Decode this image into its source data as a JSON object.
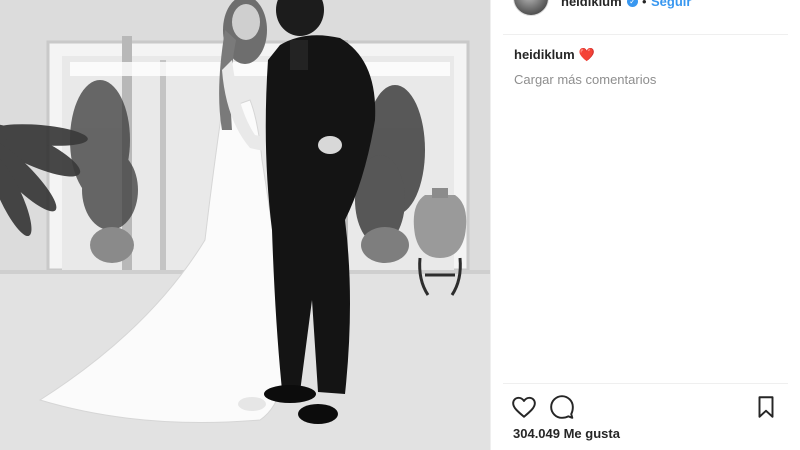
{
  "post": {
    "username": "heidiklum",
    "follow_label": "Seguir",
    "separator": "•",
    "verified_icon": "verified-badge-icon"
  },
  "caption": {
    "username": "heidiklum",
    "emoji": "❤️"
  },
  "comments": {
    "load_more": "Cargar más comentarios"
  },
  "actions": {
    "like_icon": "heart-outline-icon",
    "comment_icon": "comment-bubble-icon",
    "save_icon": "bookmark-icon"
  },
  "likes": {
    "text": "304.049 Me gusta"
  },
  "colors": {
    "link_blue": "#3897f0",
    "text": "#262626",
    "muted": "#8e8e8e",
    "heart": "#e0245e"
  }
}
